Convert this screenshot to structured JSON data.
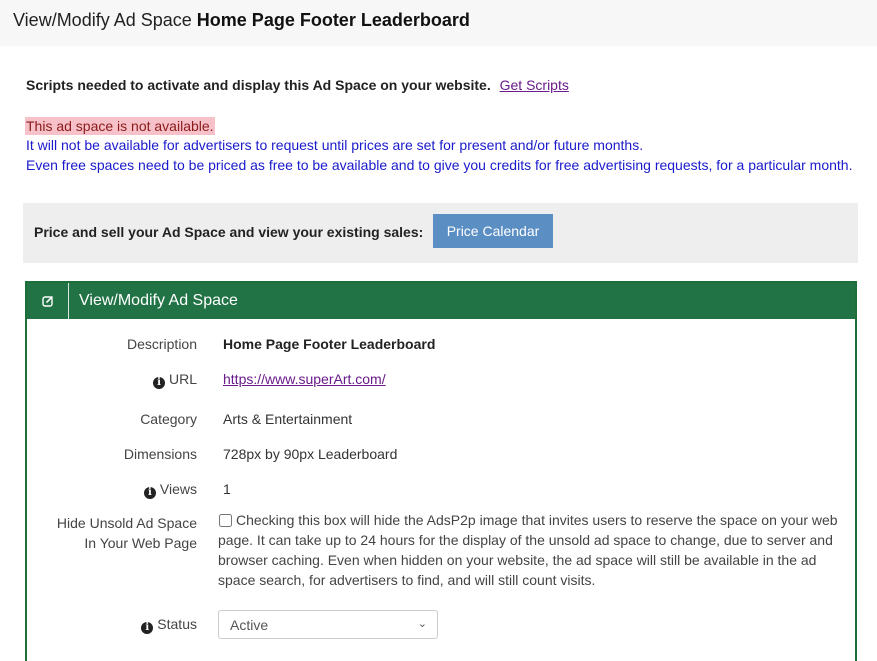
{
  "header": {
    "title_prefix": "View/Modify Ad Space",
    "title_name": "Home Page Footer Leaderboard"
  },
  "scripts": {
    "text": "Scripts needed to activate and display this Ad Space on your website.",
    "link_label": "Get Scripts"
  },
  "availability": {
    "alert": "This ad space is not available.",
    "line1": "It will not be available for advertisers to request until prices are set for present and/or future months.",
    "line2": "Even free spaces need to be priced as free to be available and to give you credits for free advertising requests, for a particular month."
  },
  "price_bar": {
    "label": "Price and sell your Ad Space and view your existing sales:",
    "button_label": "Price Calendar"
  },
  "panel": {
    "title": "View/Modify Ad Space",
    "icon": "edit-icon",
    "fields": {
      "description": {
        "label": "Description",
        "value": "Home Page Footer Leaderboard"
      },
      "url": {
        "label": "URL",
        "value": "https://www.superArt.com/",
        "icon": "info-icon"
      },
      "category": {
        "label": "Category",
        "value": "Arts & Entertainment"
      },
      "dimensions": {
        "label": "Dimensions",
        "value": "728px by 90px Leaderboard"
      },
      "views": {
        "label": "Views",
        "value": "1",
        "icon": "info-icon"
      },
      "hide_unsold": {
        "label_line1": "Hide Unsold Ad Space",
        "label_line2": "In Your Web Page",
        "checked": false,
        "text": "Checking this box will hide the AdsP2p image that invites users to reserve the space on your web page. It can take up to 24 hours for the display of the unsold ad space to change, due to server and browser caching. Even when hidden on your website, the ad space will still be available in the ad space search, for advertisers to find, and will still count visits."
      },
      "status": {
        "label": "Status",
        "value": "Active",
        "icon": "info-icon"
      }
    }
  }
}
